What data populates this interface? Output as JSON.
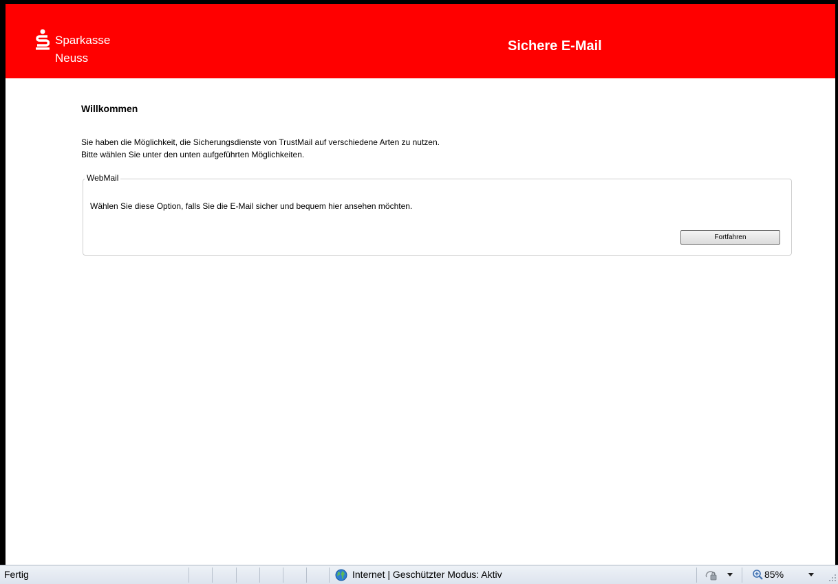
{
  "header": {
    "logo_name_line1": "Sparkasse",
    "logo_name_line2": "Neuss",
    "title": "Sichere E-Mail",
    "background_color": "#ff0000"
  },
  "main": {
    "title": "Willkommen",
    "intro_line1": "Sie haben die Möglichkeit, die Sicherungsdienste von TrustMail auf verschiedene Arten zu nutzen.",
    "intro_line2": "Bitte wählen Sie unter den unten aufgeführten Möglichkeiten.",
    "webmail": {
      "legend": "WebMail",
      "description": "Wählen Sie diese Option, falls Sie die E-Mail sicher und bequem hier ansehen möchten.",
      "button_label": "Fortfahren"
    }
  },
  "statusbar": {
    "status": "Fertig",
    "zone": "Internet | Geschützter Modus: Aktiv",
    "zoom": "85%",
    "icons": [
      "globe-icon",
      "protected-mode-icon",
      "chevron-down-icon",
      "zoom-icon",
      "resize-grip-icon"
    ]
  }
}
